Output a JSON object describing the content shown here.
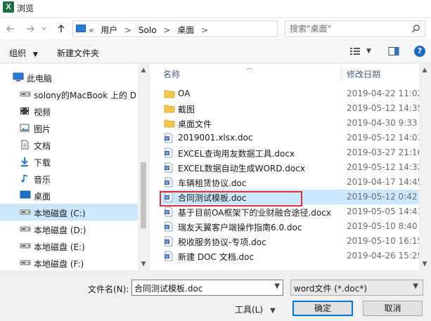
{
  "window": {
    "title": "浏览",
    "app_icon_letter": "X"
  },
  "nav": {
    "back_icon": "arrow-left-icon",
    "forward_icon": "arrow-right-icon",
    "recent_icon": "chevron-down-icon",
    "up_icon": "arrow-up-icon"
  },
  "address": {
    "overflow": "«",
    "crumbs": [
      "用户",
      "Solo",
      "桌面"
    ],
    "separator": ">",
    "dropdown_icon": "chevron-down-icon",
    "refresh_icon": "refresh-icon"
  },
  "search": {
    "placeholder": "搜索\"桌面\""
  },
  "toolbar": {
    "organize": "组织",
    "organize_caret": "▼",
    "new_folder": "新建文件夹",
    "view_icon": "view-list-icon",
    "view_caret": "▼",
    "help": "?"
  },
  "sidebar": {
    "items": [
      {
        "label": "此电脑",
        "icon": "pc-icon",
        "top": true
      },
      {
        "label": "solony的MacBook  上的 D",
        "icon": "drive-icon"
      },
      {
        "label": "视频",
        "icon": "video-icon"
      },
      {
        "label": "图片",
        "icon": "picture-icon"
      },
      {
        "label": "文档",
        "icon": "document-icon"
      },
      {
        "label": "下载",
        "icon": "download-icon"
      },
      {
        "label": "音乐",
        "icon": "music-icon"
      },
      {
        "label": "桌面",
        "icon": "desktop-icon"
      },
      {
        "label": "本地磁盘 (C:)",
        "icon": "drive-icon",
        "selected": true
      },
      {
        "label": "本地磁盘 (D:)",
        "icon": "drive-icon"
      },
      {
        "label": "本地磁盘 (E:)",
        "icon": "drive-icon"
      },
      {
        "label": "本地磁盘 (F:)",
        "icon": "drive-icon"
      }
    ]
  },
  "filelist": {
    "columns": {
      "name": "名称",
      "date": "修改日期"
    },
    "rows": [
      {
        "name": "OA",
        "date": "2019-04-22 11:02",
        "type": "folder"
      },
      {
        "name": "截图",
        "date": "2019-05-12 14:35",
        "type": "folder"
      },
      {
        "name": "桌面文件",
        "date": "2019-04-30 9:33",
        "type": "folder"
      },
      {
        "name": "2019001.xlsx.doc",
        "date": "2019-05-12 14:03",
        "type": "doc"
      },
      {
        "name": "EXCEL查询用友数据工具.docx",
        "date": "2019-03-27 21:16",
        "type": "docx"
      },
      {
        "name": "EXCEL数据自动生成WORD.docx",
        "date": "2019-05-12 14:32",
        "type": "docx"
      },
      {
        "name": "车辆租赁协议.doc",
        "date": "2019-04-17 14:45",
        "type": "doc"
      },
      {
        "name": "合同测试模板.doc",
        "date": "2019-05-12 0:42",
        "type": "doc",
        "selected": true
      },
      {
        "name": "基于目前OA框架下的业财融合途径.docx",
        "date": "2019-05-05 14:43",
        "type": "docx"
      },
      {
        "name": "瑞友天翼客户端操作指南6.0.doc",
        "date": "2019-05-10 8:40",
        "type": "docx"
      },
      {
        "name": "税收服务协议-专项.doc",
        "date": "2019-05-10 16:15",
        "type": "doc"
      },
      {
        "name": "新建 DOC 文档.doc",
        "date": "2019-04-26 15:25",
        "type": "doc"
      }
    ]
  },
  "form": {
    "filename_label": "文件名(N):",
    "filename_value": "合同测试模板.doc",
    "filetype_value": "word文件 (*.doc*)",
    "tools_label": "工具(L)",
    "ok_label": "确定",
    "cancel_label": "取消"
  },
  "colors": {
    "selection": "#cce8ff",
    "highlight_box": "#d9303a",
    "accent": "#0078d7",
    "folder": "#f3c74e",
    "word": "#2b5fb4"
  }
}
